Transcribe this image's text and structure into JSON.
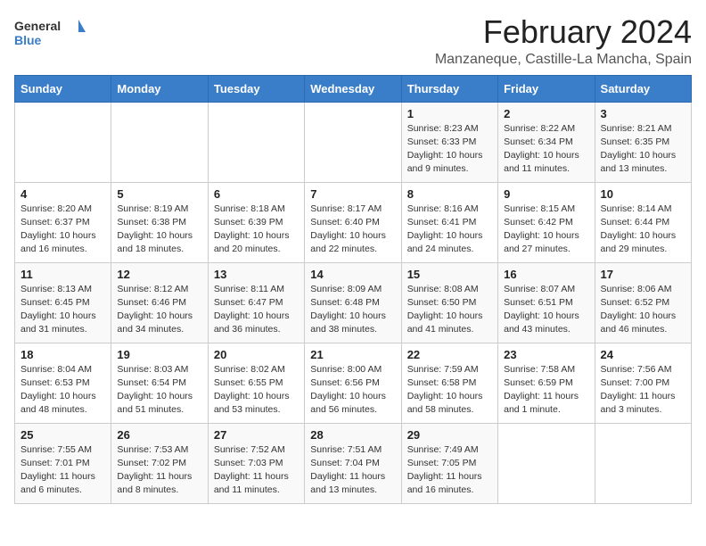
{
  "header": {
    "logo_general": "General",
    "logo_blue": "Blue",
    "title": "February 2024",
    "subtitle": "Manzaneque, Castille-La Mancha, Spain"
  },
  "weekdays": [
    "Sunday",
    "Monday",
    "Tuesday",
    "Wednesday",
    "Thursday",
    "Friday",
    "Saturday"
  ],
  "weeks": [
    [
      {
        "day": "",
        "info": ""
      },
      {
        "day": "",
        "info": ""
      },
      {
        "day": "",
        "info": ""
      },
      {
        "day": "",
        "info": ""
      },
      {
        "day": "1",
        "info": "Sunrise: 8:23 AM\nSunset: 6:33 PM\nDaylight: 10 hours and 9 minutes."
      },
      {
        "day": "2",
        "info": "Sunrise: 8:22 AM\nSunset: 6:34 PM\nDaylight: 10 hours and 11 minutes."
      },
      {
        "day": "3",
        "info": "Sunrise: 8:21 AM\nSunset: 6:35 PM\nDaylight: 10 hours and 13 minutes."
      }
    ],
    [
      {
        "day": "4",
        "info": "Sunrise: 8:20 AM\nSunset: 6:37 PM\nDaylight: 10 hours and 16 minutes."
      },
      {
        "day": "5",
        "info": "Sunrise: 8:19 AM\nSunset: 6:38 PM\nDaylight: 10 hours and 18 minutes."
      },
      {
        "day": "6",
        "info": "Sunrise: 8:18 AM\nSunset: 6:39 PM\nDaylight: 10 hours and 20 minutes."
      },
      {
        "day": "7",
        "info": "Sunrise: 8:17 AM\nSunset: 6:40 PM\nDaylight: 10 hours and 22 minutes."
      },
      {
        "day": "8",
        "info": "Sunrise: 8:16 AM\nSunset: 6:41 PM\nDaylight: 10 hours and 24 minutes."
      },
      {
        "day": "9",
        "info": "Sunrise: 8:15 AM\nSunset: 6:42 PM\nDaylight: 10 hours and 27 minutes."
      },
      {
        "day": "10",
        "info": "Sunrise: 8:14 AM\nSunset: 6:44 PM\nDaylight: 10 hours and 29 minutes."
      }
    ],
    [
      {
        "day": "11",
        "info": "Sunrise: 8:13 AM\nSunset: 6:45 PM\nDaylight: 10 hours and 31 minutes."
      },
      {
        "day": "12",
        "info": "Sunrise: 8:12 AM\nSunset: 6:46 PM\nDaylight: 10 hours and 34 minutes."
      },
      {
        "day": "13",
        "info": "Sunrise: 8:11 AM\nSunset: 6:47 PM\nDaylight: 10 hours and 36 minutes."
      },
      {
        "day": "14",
        "info": "Sunrise: 8:09 AM\nSunset: 6:48 PM\nDaylight: 10 hours and 38 minutes."
      },
      {
        "day": "15",
        "info": "Sunrise: 8:08 AM\nSunset: 6:50 PM\nDaylight: 10 hours and 41 minutes."
      },
      {
        "day": "16",
        "info": "Sunrise: 8:07 AM\nSunset: 6:51 PM\nDaylight: 10 hours and 43 minutes."
      },
      {
        "day": "17",
        "info": "Sunrise: 8:06 AM\nSunset: 6:52 PM\nDaylight: 10 hours and 46 minutes."
      }
    ],
    [
      {
        "day": "18",
        "info": "Sunrise: 8:04 AM\nSunset: 6:53 PM\nDaylight: 10 hours and 48 minutes."
      },
      {
        "day": "19",
        "info": "Sunrise: 8:03 AM\nSunset: 6:54 PM\nDaylight: 10 hours and 51 minutes."
      },
      {
        "day": "20",
        "info": "Sunrise: 8:02 AM\nSunset: 6:55 PM\nDaylight: 10 hours and 53 minutes."
      },
      {
        "day": "21",
        "info": "Sunrise: 8:00 AM\nSunset: 6:56 PM\nDaylight: 10 hours and 56 minutes."
      },
      {
        "day": "22",
        "info": "Sunrise: 7:59 AM\nSunset: 6:58 PM\nDaylight: 10 hours and 58 minutes."
      },
      {
        "day": "23",
        "info": "Sunrise: 7:58 AM\nSunset: 6:59 PM\nDaylight: 11 hours and 1 minute."
      },
      {
        "day": "24",
        "info": "Sunrise: 7:56 AM\nSunset: 7:00 PM\nDaylight: 11 hours and 3 minutes."
      }
    ],
    [
      {
        "day": "25",
        "info": "Sunrise: 7:55 AM\nSunset: 7:01 PM\nDaylight: 11 hours and 6 minutes."
      },
      {
        "day": "26",
        "info": "Sunrise: 7:53 AM\nSunset: 7:02 PM\nDaylight: 11 hours and 8 minutes."
      },
      {
        "day": "27",
        "info": "Sunrise: 7:52 AM\nSunset: 7:03 PM\nDaylight: 11 hours and 11 minutes."
      },
      {
        "day": "28",
        "info": "Sunrise: 7:51 AM\nSunset: 7:04 PM\nDaylight: 11 hours and 13 minutes."
      },
      {
        "day": "29",
        "info": "Sunrise: 7:49 AM\nSunset: 7:05 PM\nDaylight: 11 hours and 16 minutes."
      },
      {
        "day": "",
        "info": ""
      },
      {
        "day": "",
        "info": ""
      }
    ]
  ]
}
